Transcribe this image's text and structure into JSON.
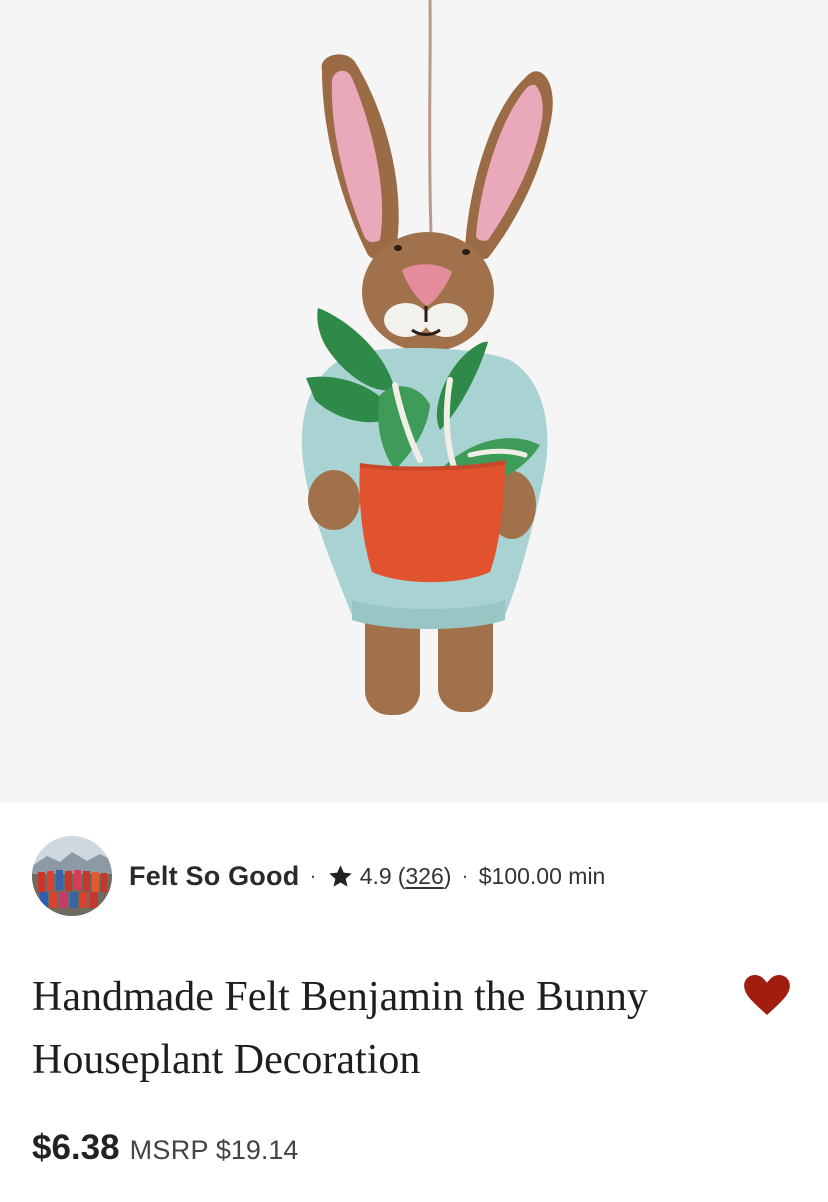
{
  "shop": {
    "name": "Felt So Good",
    "rating": "4.9",
    "review_count": "326",
    "min_order": "$100.00 min",
    "separator": "·"
  },
  "product": {
    "title": "Handmade Felt Benjamin the Bunny Houseplant Decoration",
    "price": "$6.38",
    "msrp_label": "MSRP",
    "msrp_value": "$19.14",
    "favorited": true
  },
  "colors": {
    "image_background": "#f5f5f5",
    "favorite_heart": "#a11d0f",
    "star": "#222222"
  },
  "icons": {
    "rating": "star-icon",
    "favorite": "heart-icon"
  }
}
